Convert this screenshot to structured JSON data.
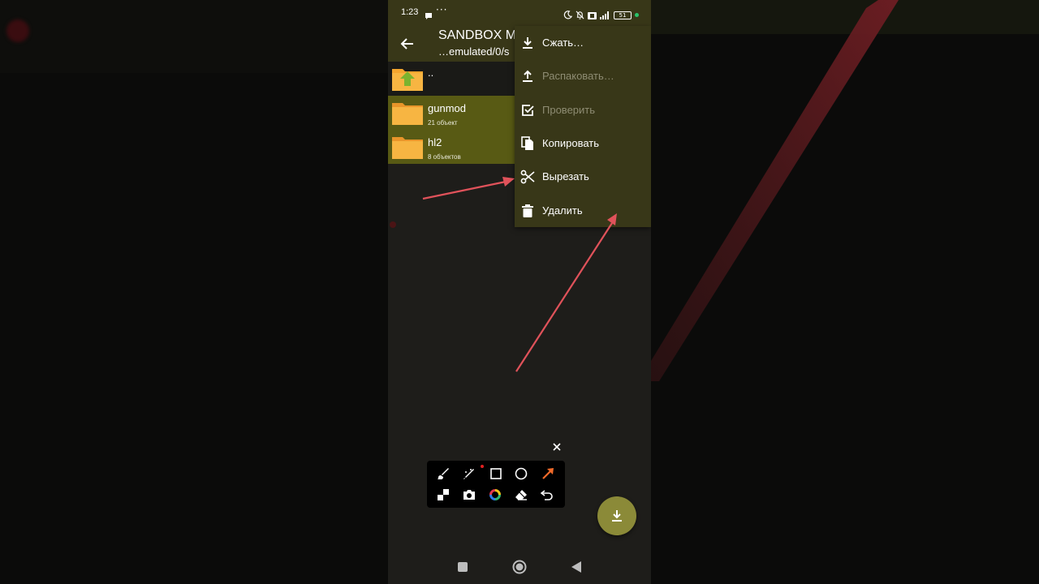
{
  "status_bar": {
    "time": "1:23",
    "more": "···",
    "battery": "51",
    "icons": [
      "chat-icon",
      "moon-icon",
      "bell-off-icon",
      "sim-icon",
      "signal-icon",
      "battery-icon",
      "privacy-dot-icon"
    ]
  },
  "app_bar": {
    "title": "SANDBOX M",
    "subtitle": "…emulated/0/s"
  },
  "file_list": {
    "parent_label": "..",
    "items": [
      {
        "name": "gunmod",
        "meta": "21 объект"
      },
      {
        "name": "hl2",
        "meta": "8 объектов"
      }
    ]
  },
  "context_menu": {
    "items": [
      {
        "label": "Сжать…",
        "icon": "download-icon",
        "enabled": true
      },
      {
        "label": "Распаковать…",
        "icon": "upload-icon",
        "enabled": false
      },
      {
        "label": "Проверить",
        "icon": "check-box-icon",
        "enabled": false
      },
      {
        "label": "Копировать",
        "icon": "copy-icon",
        "enabled": true
      },
      {
        "label": "Вырезать",
        "icon": "scissors-icon",
        "enabled": true
      },
      {
        "label": "Удалить",
        "icon": "trash-icon",
        "enabled": true
      }
    ]
  },
  "drawing_toolbar": {
    "tools": [
      "brush-icon",
      "magic-pen-icon",
      "rectangle-icon",
      "circle-icon",
      "arrow-tool-icon",
      "mosaic-icon",
      "camera-icon",
      "color-wheel-icon",
      "eraser-icon",
      "undo-icon"
    ]
  },
  "colors": {
    "app_bar": "#383718",
    "selection": "#585a14",
    "fab": "#8b8a38",
    "annotation_arrow": "#e0525a",
    "folder": "#f4a52e"
  }
}
